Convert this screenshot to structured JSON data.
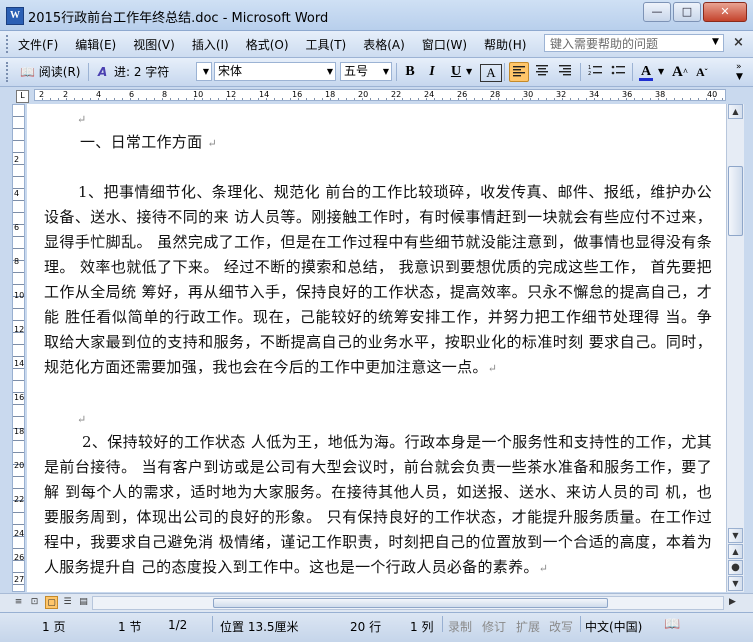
{
  "window": {
    "title": "2015行政前台工作年终总结.doc - Microsoft Word",
    "app_icon_letter": "W",
    "minimize": "—",
    "maximize": "□",
    "close": "✕"
  },
  "menubar": {
    "items": [
      {
        "label": "文件(F)"
      },
      {
        "label": "编辑(E)"
      },
      {
        "label": "视图(V)"
      },
      {
        "label": "插入(I)"
      },
      {
        "label": "格式(O)"
      },
      {
        "label": "工具(T)"
      },
      {
        "label": "表格(A)"
      },
      {
        "label": "窗口(W)"
      },
      {
        "label": "帮助(H)"
      }
    ],
    "help_placeholder": "键入需要帮助的问题",
    "close_doc": "×"
  },
  "toolbar": {
    "read_label": "阅读(R)",
    "indent_label": "进: 2 字符",
    "font_name": "宋体",
    "font_size": "五号",
    "bold": "B",
    "italic": "I",
    "underline": "U",
    "char_border": "A",
    "font_color_letter": "A",
    "grow_font": "A",
    "shrink_font": "A",
    "font_color_hex": "#1f2fd0",
    "active_hex": "#ffc66a"
  },
  "ruler": {
    "numbers": [
      "2",
      "2",
      "4",
      "6",
      "8",
      "10",
      "12",
      "14",
      "16",
      "18",
      "20",
      "22",
      "24",
      "26",
      "28",
      "30",
      "32",
      "34",
      "36",
      "38",
      "40"
    ],
    "corner": "L"
  },
  "vruler": {
    "numbers": [
      "2",
      "4",
      "6",
      "8",
      "10",
      "12",
      "14",
      "16",
      "18",
      "20",
      "22",
      "24",
      "26",
      "27"
    ]
  },
  "document": {
    "blank_mark": "↵",
    "heading": "一、日常工作方面 ",
    "para1": "1、把事情细节化、条理化、规范化 前台的工作比较琐碎，收发传真、邮件、报纸，维护办公设备、送水、接待不同的来 访人员等。刚接触工作时，有时候事情赶到一块就会有些应付不过来，显得手忙脚乱。 虽然完成了工作，但是在工作过程中有些细节就没能注意到，做事情也显得没有条理。 效率也就低了下来。 经过不断的摸索和总结， 我意识到要想优质的完成这些工作， 首先要把工作从全局统 筹好，再从细节入手，保持良好的工作状态，提高效率。只永不懈怠的提高自己，才能 胜任看似简单的行政工作。现在，己能较好的统筹安排工作，并努力把工作细节处理得 当。争取给大家最到位的支持和服务，不断提高自己的业务水平，按职业化的标准时刻 要求自己。同时，规范化方面还需要加强，我也会在今后的工作中更加注意这一点。",
    "para2": "2、保持较好的工作状态 人低为王，地低为海。行政本身是一个服务性和支持性的工作，尤其是前台接待。 当有客户到访或是公司有大型会议时，前台就会负责一些茶水准备和服务工作，要了解 到每个人的需求，适时地为大家服务。在接待其他人员，如送报、送水、来访人员的司 机，也要服务周到，体现出公司的良好的形象。 只有保持良好的工作状态，才能提升服务质量。在工作过程中，我要求自己避免消 极情绪，谨记工作职责，时刻把自己的位置放到一个合适的高度，本着为人服务提升自 己的态度投入到工作中。这也是",
    "para2_tail": "一个行政人员必备的素养。"
  },
  "statusbar": {
    "page": "1 页",
    "section": "1 节",
    "page_of": "1/2",
    "position": "位置 13.5厘米",
    "line": "20 行",
    "column": "1 列",
    "rec": "录制",
    "trk": "修订",
    "ext": "扩展",
    "ovr": "改写",
    "language": "中文(中国)"
  }
}
